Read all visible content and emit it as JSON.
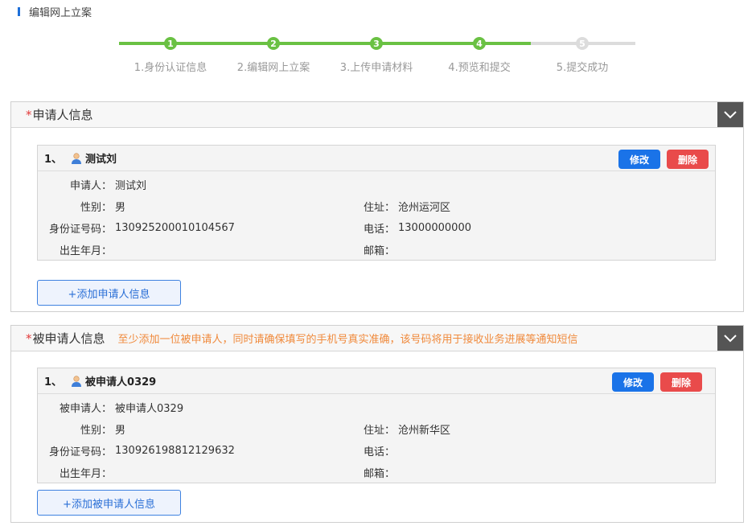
{
  "page": {
    "title": "编辑网上立案"
  },
  "steps": [
    {
      "num": "1",
      "label": "1.身份认证信息",
      "done": true
    },
    {
      "num": "2",
      "label": "2.编辑网上立案",
      "done": true
    },
    {
      "num": "3",
      "label": "3.上传申请材料",
      "done": true
    },
    {
      "num": "4",
      "label": "4.预览和提交",
      "done": true
    },
    {
      "num": "5",
      "label": "5.提交成功",
      "done": false
    }
  ],
  "applicant": {
    "required_mark": "*",
    "title": "申请人信息",
    "card": {
      "index": "1、",
      "name": "测试刘",
      "edit_label": "修改",
      "delete_label": "删除",
      "fields": {
        "applicant_label": "申请人：",
        "applicant_value": "测试刘",
        "gender_label": "性别：",
        "gender_value": "男",
        "address_label": "住址：",
        "address_value": "沧州运河区",
        "id_label": "身份证号码：",
        "id_value": "130925200010104567",
        "phone_label": "电话：",
        "phone_value": "13000000000",
        "birth_label": "出生年月：",
        "birth_value": "",
        "email_label": "邮箱：",
        "email_value": ""
      }
    },
    "add_label": "+添加申请人信息"
  },
  "respondent": {
    "required_mark": "*",
    "title": "被申请人信息",
    "hint": "至少添加一位被申请人，同时请确保填写的手机号真实准确，该号码将用于接收业务进展等通知短信",
    "card": {
      "index": "1、",
      "name": "被申请人0329",
      "edit_label": "修改",
      "delete_label": "删除",
      "fields": {
        "respondent_label": "被申请人：",
        "respondent_value": "被申请人0329",
        "gender_label": "性别：",
        "gender_value": "男",
        "address_label": "住址：",
        "address_value": "沧州新华区",
        "id_label": "身份证号码：",
        "id_value": "130926198812129632",
        "phone_label": "电话：",
        "phone_value": "",
        "birth_label": "出生年月：",
        "birth_value": "",
        "email_label": "邮箱：",
        "email_value": ""
      }
    },
    "add_label": "+添加被申请人信息"
  },
  "colors": {
    "accent_blue": "#1a73e8",
    "danger_red": "#e94b4b",
    "step_done": "#6ac143",
    "step_todo": "#dcdcdc",
    "hint_orange": "#f08a3c"
  },
  "icons": {
    "collapse": "chevron-down-icon",
    "person": "person-icon"
  }
}
